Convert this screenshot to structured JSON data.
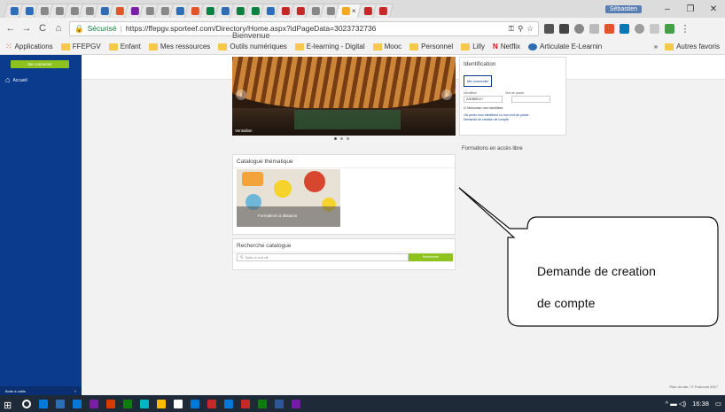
{
  "browser": {
    "tab_favicon_colors": [
      "#2d6db5",
      "#2d6db5",
      "#888",
      "#888",
      "#888",
      "#888",
      "#2d6db5",
      "#e1552d",
      "#7b1fa2",
      "#888",
      "#888",
      "#2d6db5",
      "#e1552d",
      "#0b8043",
      "#2d6db5",
      "#0b8043",
      "#0b8043",
      "#2d6db5",
      "#c62828",
      "#c62828",
      "#888",
      "#888",
      "#f5a623",
      "#c62828",
      "#c62828"
    ],
    "active_tab_close": "×",
    "profile_label": "Sébastien",
    "window_controls": {
      "minimize": "–",
      "restore": "❐",
      "close": "✕"
    }
  },
  "address_bar": {
    "back": "←",
    "forward": "→",
    "reload": "C",
    "home": "⌂",
    "secure_label": "Sécurisé",
    "url": "https://ffepgv.sporteef.com/Directory/Home.aspx?idPageData=3023732736"
  },
  "bookmarks": {
    "apps_label": "Applications",
    "items": [
      "FFEPGV",
      "Enfant",
      "Mes ressources",
      "Outils numériques",
      "E-learning - Digital",
      "Mooc",
      "Personnel",
      "Lilly",
      "Netflix",
      "Articulate E-Learnin"
    ],
    "overflow": "»",
    "other_label": "Autres favoris"
  },
  "sidebar": {
    "connect_button": "Me connecter",
    "home_label": "Accueil",
    "bottom_label": "Boite à outils",
    "bottom_chevron": "˅"
  },
  "page": {
    "welcome": "Bienvenue",
    "slider_caption": "Ventaillan",
    "prev_arrow": "‹",
    "next_arrow": "›",
    "identification": {
      "title": "Identification",
      "connect_button": "Me connecter",
      "login_label": "Identifiant",
      "password_label": "Mot de passe",
      "login_value": "ZZE8BRJ27",
      "password_value": "",
      "remember_label": "☑ Mémoriser mon identifiant",
      "forgot_link": "J'ai perdu mon identifiant ou mon mot de passe",
      "create_account_link": "Demande de création de compte"
    },
    "formations_label": "Formations en accès libre",
    "catalogue": {
      "title": "Catalogue thématique",
      "tile_label": "Formations à distance"
    },
    "recherche": {
      "title": "Recherche catalogue",
      "search_icon": "🔍",
      "placeholder": "Saisir un mot clé",
      "button": "Rechercher"
    },
    "footer": "Plan du site / © Fusionnit 2017"
  },
  "annotation": {
    "line1": "Demande de creation",
    "line2": "de compte"
  },
  "taskbar": {
    "time": "16:38",
    "tray": "^ ▬ ◁) ",
    "notification_icon": "▭",
    "app_colors": [
      "#ffffff",
      "#d83b01",
      "#0078d7",
      "#2d6db5",
      "#0078d7",
      "#7b1fa2",
      "#d83b01",
      "#107c10",
      "#00b7c3",
      "#ffb900",
      "#ffffff",
      "#0078d7",
      "#c62828",
      "#0078d7",
      "#c62828",
      "#107c10",
      "#2b579a",
      "#7719aa"
    ]
  }
}
